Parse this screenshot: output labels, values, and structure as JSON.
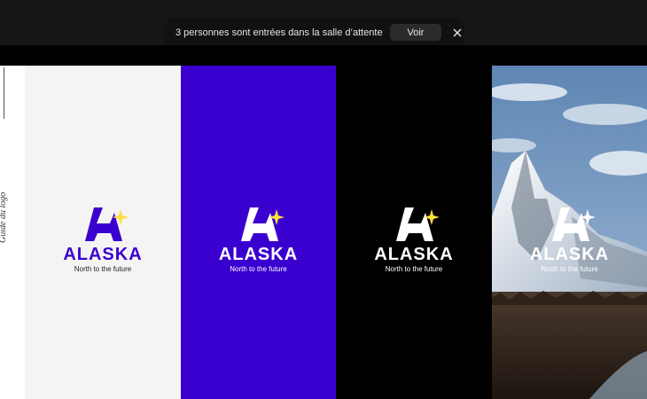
{
  "notification": {
    "message": "3 personnes sont entrées dans la salle d’attente",
    "action_label": "Voir"
  },
  "sidebar": {
    "label": "Guide du logo"
  },
  "logo": {
    "name": "ALASKA",
    "tagline": "North to the future"
  },
  "colors": {
    "topbar": "#161616",
    "panel_light": "#f4f4f4",
    "panel_brand": "#3a00cf",
    "panel_dark": "#000000",
    "logo_purple": "#3a00cf",
    "star_yellow": "#ffdf3a"
  },
  "panels": [
    {
      "background": "light",
      "logo_color": "purple"
    },
    {
      "background": "brand",
      "logo_color": "white"
    },
    {
      "background": "dark",
      "logo_color": "white"
    },
    {
      "background": "photo",
      "logo_color": "white",
      "photo_subject": "snowy mountain and forest"
    }
  ]
}
